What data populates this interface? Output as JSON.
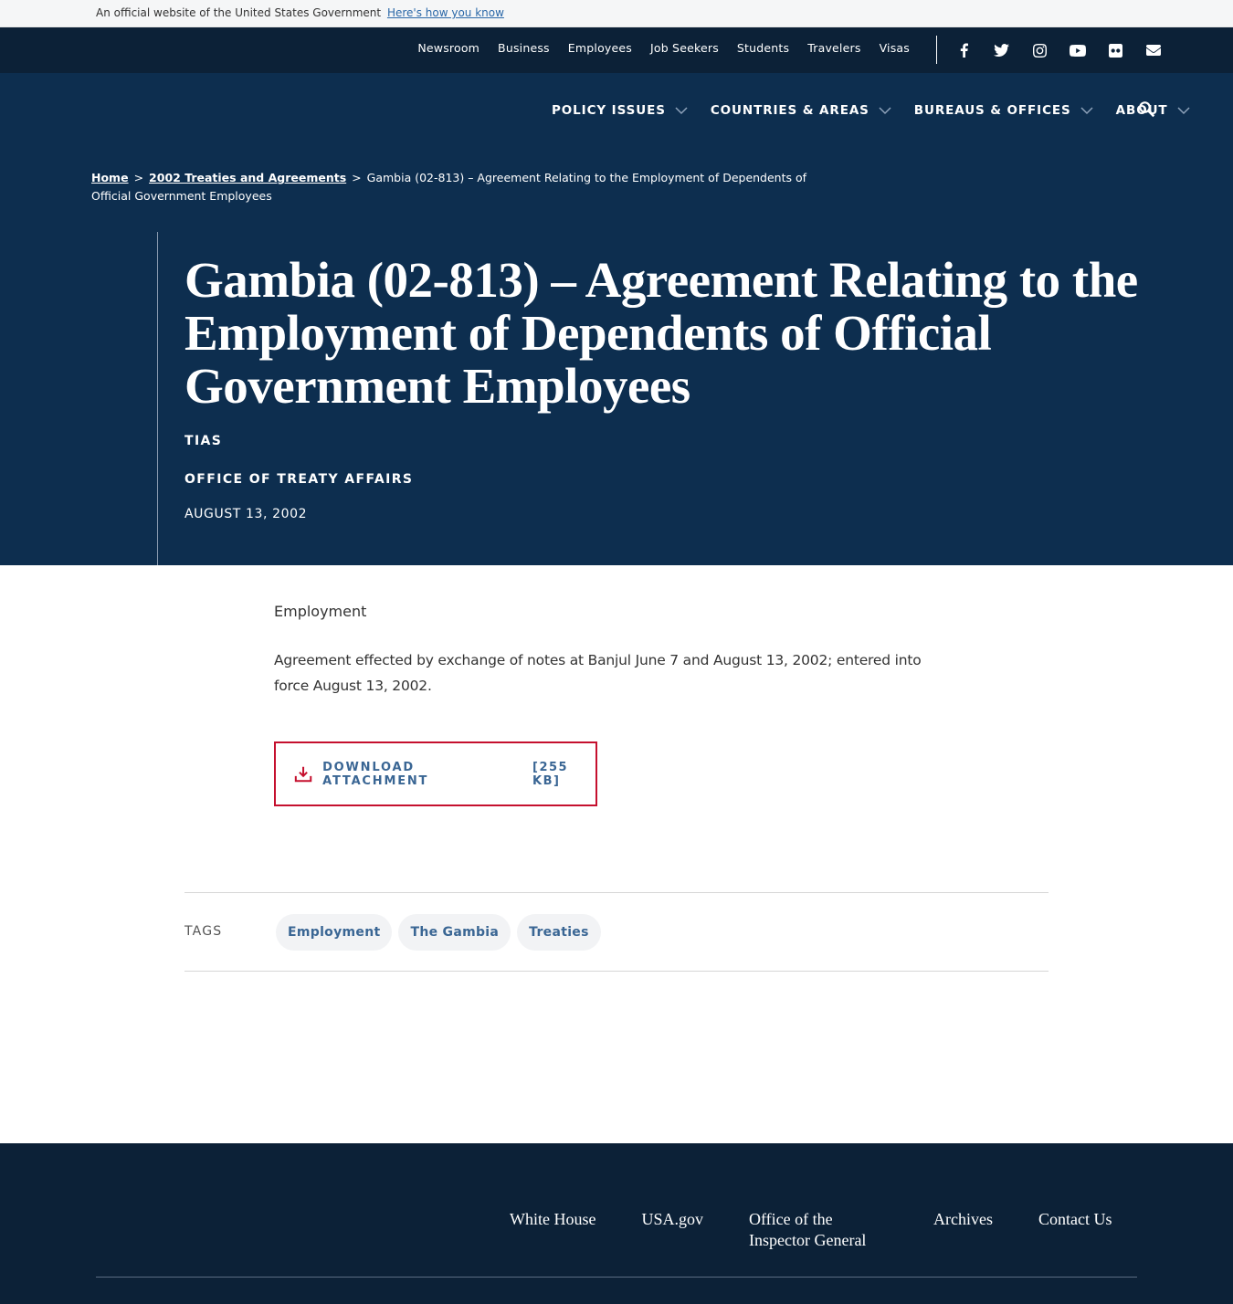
{
  "gov_banner": {
    "text": "An official website of the United States Government",
    "link": "Here's how you know"
  },
  "utility_nav": {
    "links": [
      "Newsroom",
      "Business",
      "Employees",
      "Job Seekers",
      "Students",
      "Travelers",
      "Visas"
    ],
    "social_icons": [
      "facebook-icon",
      "twitter-icon",
      "instagram-icon",
      "youtube-icon",
      "flickr-icon",
      "email-icon"
    ]
  },
  "main_nav": {
    "items": [
      "POLICY ISSUES",
      "COUNTRIES & AREAS",
      "BUREAUS & OFFICES",
      "ABOUT"
    ],
    "search_icon": "search-icon"
  },
  "breadcrumb": {
    "home": "Home",
    "parent": "2002 Treaties and Agreements",
    "current": "Gambia (02-813) – Agreement Relating to the Employment of Dependents of Official Government Employees",
    "separator": ">"
  },
  "hero": {
    "title": "Gambia (02-813) – Agreement Relating to the Employment of Dependents of Official Government Employees",
    "type": "TIAS",
    "office": "OFFICE OF TREATY AFFAIRS",
    "date": "AUGUST 13, 2002"
  },
  "content": {
    "category": "Employment",
    "description": "Agreement effected by exchange of notes at Banjul June 7 and August 13, 2002; entered into force August 13, 2002."
  },
  "download": {
    "label": "DOWNLOAD ATTACHMENT",
    "size": "[255 KB]",
    "icon": "download-icon",
    "border_color": "#c5102e"
  },
  "tags": {
    "label": "TAGS",
    "items": [
      "Employment",
      "The Gambia",
      "Treaties"
    ]
  },
  "footer": {
    "links": [
      "White House",
      "USA.gov",
      "Office of the Inspector General",
      "Archives",
      "Contact Us"
    ]
  },
  "colors": {
    "navy_dark": "#0c2137",
    "navy": "#0d2e4f",
    "link_blue": "#3a6694",
    "accent_red": "#c5102e"
  }
}
